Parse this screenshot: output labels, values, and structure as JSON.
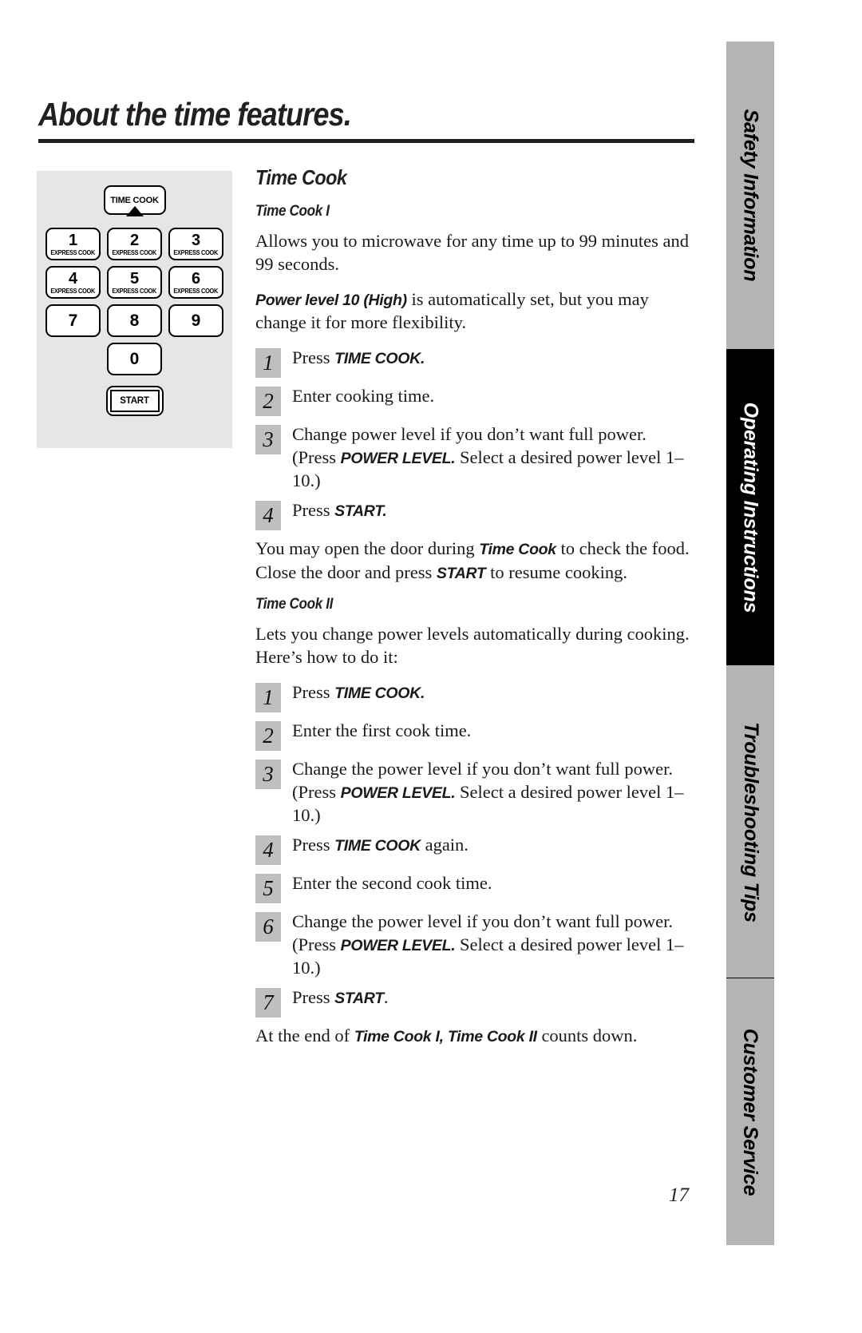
{
  "header": {
    "title": "About the time features."
  },
  "page_number": "17",
  "sidebar": {
    "tabs": [
      {
        "label": "Safety Information",
        "state": "inactive"
      },
      {
        "label": "Operating Instructions",
        "state": "active"
      },
      {
        "label": "Troubleshooting Tips",
        "state": "inactive"
      },
      {
        "label": "Customer Service",
        "state": "inactive"
      }
    ]
  },
  "keypad": {
    "time_cook_label": "TIME COOK",
    "express_cook_sub": "EXPRESS COOK",
    "start_label": "START",
    "rows": [
      [
        {
          "digit": "1",
          "sub": "EXPRESS COOK"
        },
        {
          "digit": "2",
          "sub": "EXPRESS COOK"
        },
        {
          "digit": "3",
          "sub": "EXPRESS COOK"
        }
      ],
      [
        {
          "digit": "4",
          "sub": "EXPRESS COOK"
        },
        {
          "digit": "5",
          "sub": "EXPRESS COOK"
        },
        {
          "digit": "6",
          "sub": "EXPRESS COOK"
        }
      ],
      [
        {
          "digit": "7",
          "sub": ""
        },
        {
          "digit": "8",
          "sub": ""
        },
        {
          "digit": "9",
          "sub": ""
        }
      ]
    ],
    "zero": {
      "digit": "0",
      "sub": ""
    }
  },
  "content": {
    "section_title": "Time Cook",
    "time_cook_1": {
      "heading": "Time Cook I",
      "intro": "Allows you to microwave for any time up to 99 minutes and 99 seconds.",
      "power_note_bold": "Power level 10 (High)",
      "power_note_rest": " is automatically set, but you may change it for more flexibility.",
      "steps": [
        {
          "num": "1",
          "pre": "Press ",
          "bold": "TIME COOK.",
          "post": ""
        },
        {
          "num": "2",
          "pre": "Enter cooking time.",
          "bold": "",
          "post": ""
        },
        {
          "num": "3",
          "pre": "Change power level if you don’t want full power. (Press ",
          "bold": "POWER LEVEL.",
          "post": " Select a desired power level 1–10.)"
        },
        {
          "num": "4",
          "pre": "Press ",
          "bold": "START.",
          "post": ""
        }
      ],
      "note_1": "You may open the door during ",
      "note_bold_1": "Time Cook",
      "note_2": " to check the food. Close the door and press ",
      "note_bold_2": "START",
      "note_3": " to resume cooking."
    },
    "time_cook_2": {
      "heading": "Time Cook II",
      "intro": "Lets you change power levels automatically during cooking. Here’s how to do it:",
      "steps": [
        {
          "num": "1",
          "pre": "Press ",
          "bold": "TIME COOK.",
          "post": ""
        },
        {
          "num": "2",
          "pre": "Enter the first cook time.",
          "bold": "",
          "post": ""
        },
        {
          "num": "3",
          "pre": "Change the power level if you don’t want full power. (Press ",
          "bold": "POWER LEVEL.",
          "post": " Select a desired power level 1–10.)"
        },
        {
          "num": "4",
          "pre": "Press ",
          "bold": "TIME COOK",
          "post": " again."
        },
        {
          "num": "5",
          "pre": "Enter the second cook time.",
          "bold": "",
          "post": ""
        },
        {
          "num": "6",
          "pre": "Change the power level if you don’t want full power. (Press ",
          "bold": "POWER LEVEL.",
          "post": " Select a desired power level 1–10.)"
        },
        {
          "num": "7",
          "pre": "Press ",
          "bold": "START",
          "post": "."
        }
      ],
      "closing_1": "At the end of ",
      "closing_bold": "Time Cook I, Time Cook II",
      "closing_2": " counts down."
    }
  }
}
